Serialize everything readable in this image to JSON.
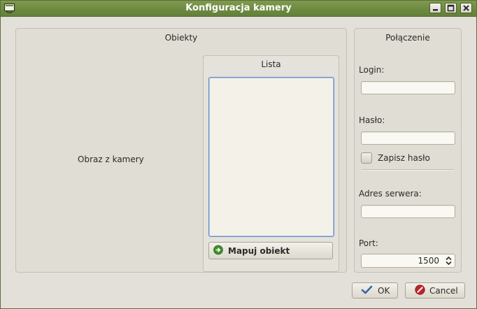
{
  "window": {
    "title": "Konfiguracja kamery"
  },
  "icons": {
    "app": "window-icon",
    "minimize": "minimize-icon",
    "maximize": "maximize-icon",
    "close": "close-icon"
  },
  "obiekty": {
    "title": "Obiekty",
    "camera_placeholder": "Obraz z kamery",
    "lista": {
      "title": "Lista",
      "items": []
    },
    "map_button": "Mapuj obiekt"
  },
  "polaczenie": {
    "title": "Połączenie",
    "login_label": "Login:",
    "login_value": "",
    "password_label": "Hasło:",
    "password_value": "",
    "save_password_label": "Zapisz hasło",
    "save_password_checked": false,
    "server_label": "Adres serwera:",
    "server_value": "",
    "port_label": "Port:",
    "port_value": "1500"
  },
  "footer": {
    "ok_label": "OK",
    "cancel_label": "Cancel"
  },
  "colors": {
    "titlebar": "#6e8b41",
    "ok_icon": "#3b63a8",
    "cancel_icon": "#c0262a",
    "map_icon": "#3f8f2c"
  }
}
